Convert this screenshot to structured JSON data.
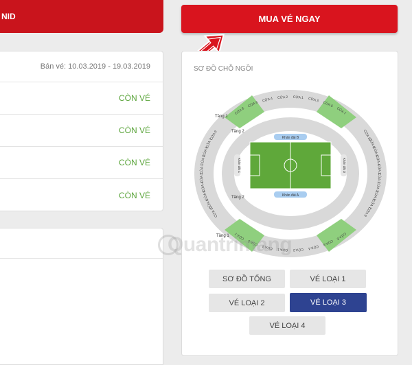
{
  "left": {
    "header_text": "NID",
    "sale_period": "Bán vé: 10.03.2019 - 19.03.2019",
    "rows": [
      {
        "status": "CÒN VÉ"
      },
      {
        "status": "CÒN VÉ"
      },
      {
        "status": "CÒN VÉ"
      },
      {
        "status": "CÒN VÉ"
      }
    ]
  },
  "buy_button": {
    "label": "MUA VÉ NGAY"
  },
  "seat_map": {
    "title": "SƠ ĐỒ CHỖ NGỒI",
    "stands": {
      "north": "Khán đài B",
      "south": "Khán đài A",
      "west": "Khán đài C",
      "east": "Khán đài D"
    },
    "tiers": {
      "tier2": "Tầng 2",
      "tier1": "Tầng 1"
    },
    "gates_top": [
      "CỬA 8",
      "CỬA 6",
      "CỬA 4",
      "CỬA 2",
      "CỬA 1",
      "CỬA 3",
      "CỬA 5",
      "CỬA 7"
    ],
    "gates_bottom": [
      "CỬA 7",
      "CỬA 5",
      "CỬA 3",
      "CỬA 1",
      "CỬA 2",
      "CỬA 4",
      "CỬA 6",
      "CỬA 8"
    ],
    "gates_left": [
      "CỬA 9",
      "CỬA 7",
      "CỬA 5",
      "CỬA 3",
      "CỬA 1",
      "CỬA 2",
      "CỬA 4",
      "CỬA 6",
      "CỬA 8",
      "CỬA 10"
    ],
    "gates_right": [
      "CỬA 10",
      "CỬA 8",
      "CỬA 6",
      "CỬA 4",
      "CỬA 2",
      "CỬA 1",
      "CỬA 3",
      "CỬA 5",
      "CỬA 7",
      "CỬA 9"
    ],
    "highlight_color": "#8fcf7e",
    "seat_color": "#d9d9d9",
    "pitch_color": "#5fa83a"
  },
  "ticket_types": {
    "overview": "SƠ ĐỒ TỔNG",
    "type1": "VÉ LOẠI 1",
    "type2": "VÉ LOẠI 2",
    "type3": "VÉ LOẠI 3",
    "type4": "VÉ LOẠI 4"
  },
  "watermark": "Quantrimang",
  "colors": {
    "brand_red": "#d9141e",
    "active_blue": "#2e4391",
    "available_green": "#5aa43a"
  }
}
